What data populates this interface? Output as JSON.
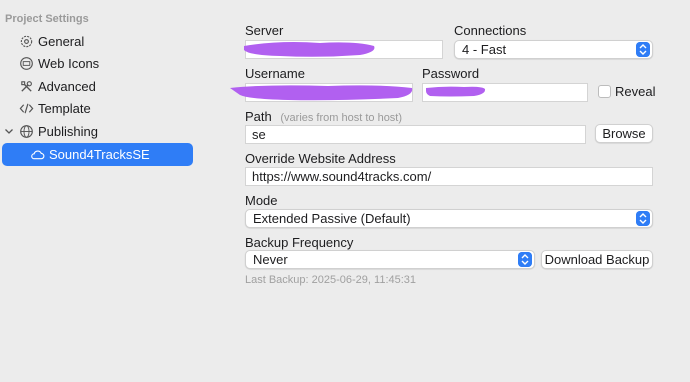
{
  "sidebar": {
    "header": "Project Settings",
    "items": [
      {
        "label": "General",
        "icon": "gear-icon"
      },
      {
        "label": "Web Icons",
        "icon": "web-icons-icon"
      },
      {
        "label": "Advanced",
        "icon": "tools-icon"
      },
      {
        "label": "Template",
        "icon": "code-icon"
      },
      {
        "label": "Publishing",
        "icon": "globe-icon",
        "expanded": true
      },
      {
        "label": "Sound4TracksSE",
        "icon": "cloud-icon",
        "selected": true
      }
    ]
  },
  "form": {
    "server_label": "Server",
    "server_value": "",
    "connections_label": "Connections",
    "connections_value": "4 - Fast",
    "username_label": "Username",
    "username_value": "",
    "password_label": "Password",
    "password_value": "",
    "reveal_label": "Reveal",
    "reveal_checked": false,
    "path_label": "Path",
    "path_hint": "(varies from host to host)",
    "path_value": "se",
    "browse_label": "Browse",
    "override_label": "Override Website Address",
    "override_value": "https://www.sound4tracks.com/",
    "mode_label": "Mode",
    "mode_value": "Extended Passive (Default)",
    "backup_label": "Backup Frequency",
    "backup_value": "Never",
    "download_label": "Download Backup",
    "last_backup": "Last Backup: 2025-06-29, 11:45:31"
  },
  "colors": {
    "accent": "#2f7df6",
    "redaction": "#b160f0",
    "window_bg": "#ececec"
  }
}
